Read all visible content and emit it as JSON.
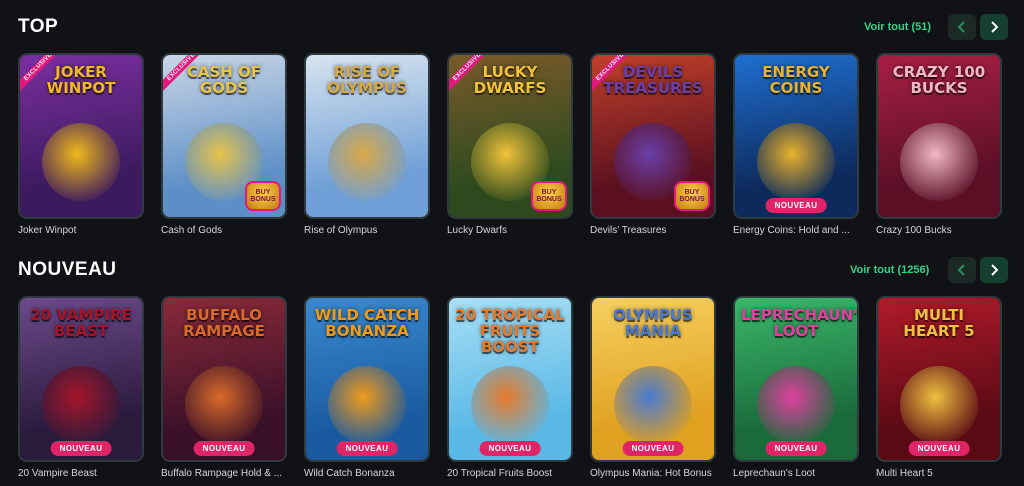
{
  "sections": [
    {
      "heading": "TOP",
      "see_all": "Voir tout (51)",
      "games": [
        {
          "name": "Joker Winpot",
          "art_title": "JOKER WINPOT",
          "ribbon": "EXCLUSIVE",
          "buy_badge": "",
          "new_badge": "",
          "colors": [
            "#3c1a5e",
            "#7a2fa0",
            "#f0b91c"
          ]
        },
        {
          "name": "Cash of Gods",
          "art_title": "CASH OF GODS",
          "ribbon": "EXCLUSIVE",
          "buy_badge": "BUY BONUS",
          "new_badge": "",
          "colors": [
            "#5d8fc7",
            "#c9d6e6",
            "#e7c44b"
          ]
        },
        {
          "name": "Rise of Olympus",
          "art_title": "RISE OF OLYMPUS",
          "ribbon": "",
          "buy_badge": "",
          "new_badge": "",
          "colors": [
            "#6f9fd6",
            "#d8e4ef",
            "#d9a847"
          ]
        },
        {
          "name": "Lucky Dwarfs",
          "art_title": "LUCKY DWARFS",
          "ribbon": "EXCLUSIVE",
          "buy_badge": "BUY BONUS",
          "new_badge": "",
          "colors": [
            "#2c4a1e",
            "#7b5a2a",
            "#f0c23a"
          ]
        },
        {
          "name": "Devils' Treasures",
          "art_title": "DEVILS TREASURES",
          "ribbon": "EXCLUSIVE",
          "buy_badge": "BUY BONUS",
          "new_badge": "",
          "colors": [
            "#5a1020",
            "#c0402a",
            "#6a3fa8"
          ]
        },
        {
          "name": "Energy Coins: Hold and ...",
          "art_title": "ENERGY COINS",
          "ribbon": "",
          "buy_badge": "",
          "new_badge": "NOUVEAU",
          "colors": [
            "#0d2a5c",
            "#1f6fd0",
            "#e8b22a"
          ]
        },
        {
          "name": "Crazy 100 Bucks",
          "art_title": "CRAZY 100 BUCKS",
          "ribbon": "",
          "buy_badge": "",
          "new_badge": "",
          "colors": [
            "#5a0f25",
            "#a81f45",
            "#f0b8c6"
          ]
        }
      ]
    },
    {
      "heading": "NOUVEAU",
      "see_all": "Voir tout (1256)",
      "games": [
        {
          "name": "20 Vampire Beast",
          "art_title": "20 VAMPIRE BEAST",
          "ribbon": "",
          "buy_badge": "",
          "new_badge": "NOUVEAU",
          "colors": [
            "#2a1a3c",
            "#6c4a8a",
            "#a3162a"
          ]
        },
        {
          "name": "Buffalo Rampage Hold & ...",
          "art_title": "BUFFALO RAMPAGE",
          "ribbon": "",
          "buy_badge": "",
          "new_badge": "NOUVEAU",
          "colors": [
            "#3a1028",
            "#8a2a3a",
            "#d86a2a"
          ]
        },
        {
          "name": "Wild Catch Bonanza",
          "art_title": "WILD CATCH BONANZA",
          "ribbon": "",
          "buy_badge": "",
          "new_badge": "NOUVEAU",
          "colors": [
            "#1a5aa0",
            "#3a8ad0",
            "#f09a1c"
          ]
        },
        {
          "name": "20 Tropical Fruits Boost",
          "art_title": "20 TROPICAL FRUITS BOOST",
          "ribbon": "",
          "buy_badge": "",
          "new_badge": "NOUVEAU",
          "colors": [
            "#5ab8e6",
            "#a8dff5",
            "#e87a2a"
          ]
        },
        {
          "name": "Olympus Mania: Hot Bonus",
          "art_title": "OLYMPUS MANIA",
          "ribbon": "",
          "buy_badge": "",
          "new_badge": "NOUVEAU",
          "colors": [
            "#e0a020",
            "#f5d060",
            "#4a7ad0"
          ]
        },
        {
          "name": "Leprechaun's Loot",
          "art_title": "LEPRECHAUN'S LOOT",
          "ribbon": "",
          "buy_badge": "",
          "new_badge": "NOUVEAU",
          "colors": [
            "#1a6a3a",
            "#3ab86a",
            "#e040a0"
          ]
        },
        {
          "name": "Multi Heart 5",
          "art_title": "MULTI HEART 5",
          "ribbon": "",
          "buy_badge": "",
          "new_badge": "NOUVEAU",
          "colors": [
            "#5a0a14",
            "#b01a2a",
            "#f0c040"
          ]
        }
      ]
    }
  ]
}
